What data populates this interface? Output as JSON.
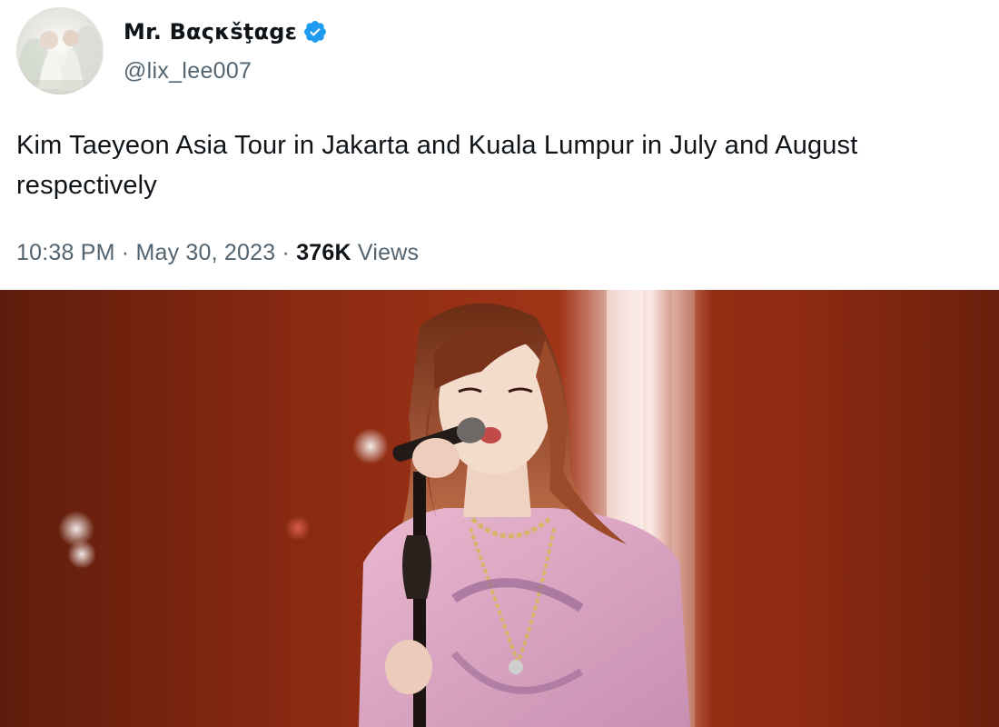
{
  "tweet": {
    "author": {
      "display_name": "Mr. Βαςκšţαgε",
      "handle": "@lix_lee007",
      "verified": true,
      "verified_icon": "verified-badge-icon",
      "verified_color": "#1d9bf0"
    },
    "text": "Kim Taeyeon Asia Tour in Jakarta and Kuala Lumpur in July and August respectively",
    "time": "10:38 PM",
    "separator": "·",
    "date": "May 30, 2023",
    "views_count": "376K",
    "views_label": "Views"
  },
  "colors": {
    "text_primary": "#0f1419",
    "text_secondary": "#536471",
    "stage_background": "#8a2a12"
  }
}
